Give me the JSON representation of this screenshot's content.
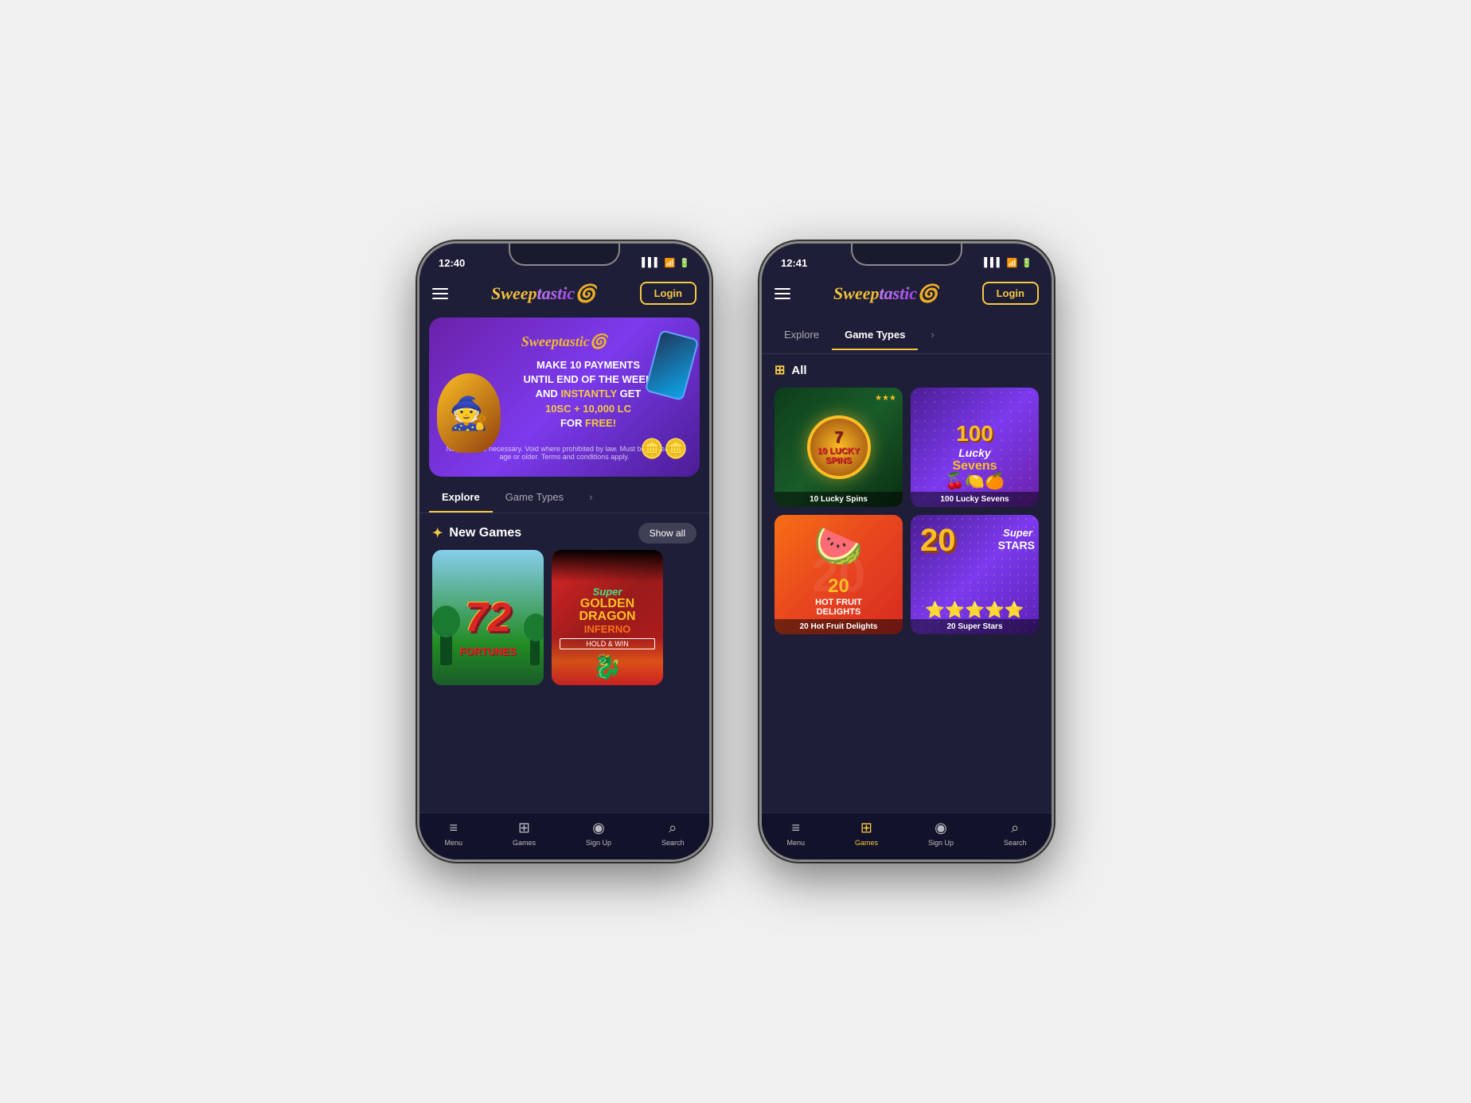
{
  "phones": [
    {
      "id": "phone-left",
      "time": "12:40",
      "logo": "Sweeptastic",
      "login_label": "Login",
      "banner": {
        "logo": "Sweeptastic",
        "headline_1": "MAKE 10 PAYMENTS",
        "headline_2": "UNTIL END OF THE WEEK",
        "headline_3": "AND ",
        "highlight": "INSTANTLY",
        "headline_4": " GET",
        "reward_1": "10SC + 10,000 LC",
        "reward_suffix": "FOR ",
        "reward_free": "FREE!",
        "disclaimer": "No purchase necessary. Void where prohibited by law. Must be 18 years of age or older. Terms and conditions apply."
      },
      "tabs": [
        {
          "label": "Explore",
          "active": true
        },
        {
          "label": "Game Types",
          "active": false
        }
      ],
      "new_games_section": {
        "title": "New Games",
        "show_all": "Show all"
      },
      "games": [
        {
          "id": "72-fortunes",
          "name": "72 Fortunes",
          "number": "72",
          "text": "FORTUNES",
          "theme": "green-forest"
        },
        {
          "id": "super-golden-dragon",
          "name": "Super Golden Dragon Inferno",
          "super": "Super",
          "golden": "GOLDEN DRAGON",
          "inferno": "INFERNO",
          "hold_win": "HOLD & WIN",
          "theme": "red"
        }
      ],
      "bottom_nav": [
        {
          "label": "Menu",
          "icon": "≡",
          "active": false
        },
        {
          "label": "Games",
          "icon": "⊞",
          "active": false
        },
        {
          "label": "Sign Up",
          "icon": "◉",
          "active": false
        },
        {
          "label": "Search",
          "icon": "⌕",
          "active": false
        }
      ]
    },
    {
      "id": "phone-right",
      "time": "12:41",
      "logo": "Sweeptastic",
      "login_label": "Login",
      "tabs": [
        {
          "label": "Explore",
          "active": false
        },
        {
          "label": "Game Types",
          "active": true
        }
      ],
      "all_label": "All",
      "grid_games": [
        {
          "id": "10-lucky-spins",
          "name": "10 Lucky Spins",
          "number": "10",
          "text": "LUCKY\nSPINS",
          "theme": "dark-green"
        },
        {
          "id": "100-lucky-sevens",
          "name": "100 Lucky Sevens",
          "number": "100",
          "theme": "purple"
        },
        {
          "id": "20-hot-fruit-delights",
          "name": "20 Hot Fruit Delights",
          "number": "20",
          "theme": "orange"
        },
        {
          "id": "20-super-stars",
          "name": "20 Super Stars",
          "number": "20",
          "theme": "purple-dark"
        }
      ],
      "bottom_nav": [
        {
          "label": "Menu",
          "icon": "≡",
          "active": false
        },
        {
          "label": "Games",
          "icon": "⊞",
          "active": true
        },
        {
          "label": "Sign Up",
          "icon": "◉",
          "active": false
        },
        {
          "label": "Search",
          "icon": "⌕",
          "active": false
        }
      ]
    }
  ]
}
